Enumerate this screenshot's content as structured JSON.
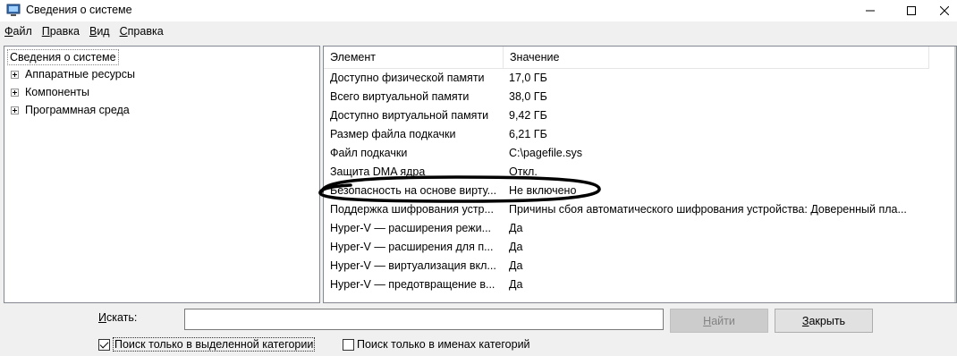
{
  "window": {
    "title": "Сведения о системе",
    "icon": "system-info-icon",
    "min_glyph": "—",
    "max_glyph": "☐",
    "close_glyph": "✕"
  },
  "menu": [
    {
      "label_first": "Ф",
      "label_rest": "айл"
    },
    {
      "label_first": "П",
      "label_rest": "равка"
    },
    {
      "label_first": "В",
      "label_rest": "ид"
    },
    {
      "label_first": "С",
      "label_rest": "правка"
    }
  ],
  "tree": {
    "root": "Сведения о системе",
    "nodes": [
      "Аппаратные ресурсы",
      "Компоненты",
      "Программная среда"
    ]
  },
  "list": {
    "columns": [
      "Элемент",
      "Значение"
    ],
    "rows": [
      {
        "key": "Доступно физической памяти",
        "value": "17,0 ГБ"
      },
      {
        "key": "Всего виртуальной памяти",
        "value": "38,0 ГБ"
      },
      {
        "key": "Доступно виртуальной памяти",
        "value": "9,42 ГБ"
      },
      {
        "key": "Размер файла подкачки",
        "value": "6,21 ГБ"
      },
      {
        "key": "Файл подкачки",
        "value": "C:\\pagefile.sys"
      },
      {
        "key": "Защита DMA ядра",
        "value": "Откл."
      },
      {
        "key": "Безопасность на основе вирту...",
        "value": "Не включено"
      },
      {
        "key": "Поддержка шифрования устр...",
        "value": "Причины сбоя автоматического шифрования устройства: Доверенный пла..."
      },
      {
        "key": "Hyper-V — расширения режи...",
        "value": "Да"
      },
      {
        "key": "Hyper-V — расширения для п...",
        "value": "Да"
      },
      {
        "key": "Hyper-V — виртуализация вкл...",
        "value": "Да"
      },
      {
        "key": "Hyper-V — предотвращение в...",
        "value": "Да"
      }
    ]
  },
  "search": {
    "label_first": "И",
    "label_rest": "скать:",
    "value": "",
    "find_first": "Н",
    "find_rest": "айти",
    "close_first": "З",
    "close_rest": "акрыть",
    "only_selected": "Поиск только в выделенной категории",
    "only_selected_checked": true,
    "only_names": "Поиск только в именах категорий",
    "only_names_checked": false
  },
  "colors": {
    "highlight_ink": "#000000",
    "disabled_button": "#cccccc"
  }
}
